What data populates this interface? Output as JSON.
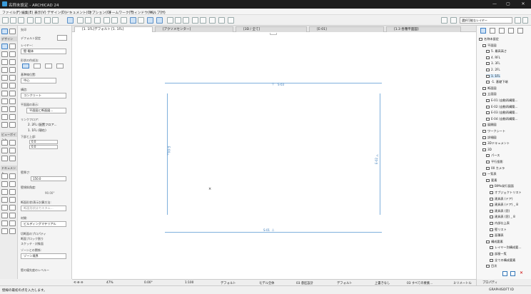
{
  "window": {
    "title": "名称未設定 - ARCHICAD 24",
    "minimize": "—",
    "maximize": "▢",
    "close": "✕"
  },
  "menu": [
    "ファイル(F)",
    "編集(E)",
    "表示(V)",
    "デザイン(D)",
    "ドキュメント(C)",
    "オプション(O)",
    "チームワーク(T)",
    "ウィンドウ(W)",
    "ヘルプ(H)"
  ],
  "toolbar": {
    "right_text": "選択可能なレイヤー"
  },
  "left_tools": {
    "select_label": "矢印",
    "sec_design": "デザイン",
    "sec_viewpoint": "ビューポイント",
    "sec_document": "ドキュメント"
  },
  "info": {
    "default_label": "デフォルト設定",
    "layer_label": "レイヤー:",
    "layer_value": "壁-躯体",
    "geometry_label": "形状の作成法:",
    "ref_label": "基準線位置:",
    "ref_value": "中心",
    "structure_label": "構造:",
    "structure_value": "コンクリート",
    "floor_label": "平面図の表示:",
    "floor_value": "平面図と断面図...",
    "link_label": "リンクフロア:",
    "top_story": "2. 2FL (配置フロア...",
    "home_story": "1. 1FL (現在)",
    "bottom_label": "下部と上部:",
    "bottom_val1": "0.0",
    "bottom_val2": "0.0",
    "thickness_label": "壁厚さ:",
    "thickness_value": "150.0",
    "slant_label": "壁傾斜角度:",
    "slant_value": "90.00°",
    "model_label": "断面形状/表示計算方法:",
    "model_value": "断面形状はカスタム...",
    "material_label": "材質:",
    "material_value": "ビルディングマテリアル",
    "r1": "切断面のプロパティ",
    "r2": "断面ブロック割り",
    "r3": "スケッチ・対象面",
    "zone_label": "ゾーンとの関係:",
    "zone_value": "ゾーン境界",
    "bottom_note": "壁の優先度のレベルー"
  },
  "tabs": [
    "[1. 1FL]デフォルト [1. 1FL]",
    "[アクソメセンター]",
    "[3D / 全て]",
    "[E-01]",
    "[1.3 各種平面図]"
  ],
  "canvas": {
    "label_top": "S-03",
    "label_bottom": "S-01",
    "label_left": "E-04",
    "label_right": "E-02"
  },
  "navigator": {
    "items": [
      {
        "t": "名称未設定",
        "d": 1
      },
      {
        "t": "平面図",
        "d": 2
      },
      {
        "t": "5. 最高高さ",
        "d": 3
      },
      {
        "t": "4. RFL",
        "d": 3
      },
      {
        "t": "3. 3FL",
        "d": 3
      },
      {
        "t": "2. 2FL",
        "d": 3
      },
      {
        "t": "1. 1FL",
        "d": 3,
        "sel": true
      },
      {
        "t": "-1. 基礎下端",
        "d": 3
      },
      {
        "t": "断面図",
        "d": 2
      },
      {
        "t": "立面図",
        "d": 2
      },
      {
        "t": "E-01 (自動再構築…",
        "d": 3
      },
      {
        "t": "E-02 (自動再構築…",
        "d": 3
      },
      {
        "t": "E-03 (自動再構築…",
        "d": 3
      },
      {
        "t": "E-04 (自動再構築…",
        "d": 3
      },
      {
        "t": "展開図",
        "d": 2
      },
      {
        "t": "ワークシート",
        "d": 2
      },
      {
        "t": "詳細図",
        "d": 2
      },
      {
        "t": "3Dドキュメント",
        "d": 2
      },
      {
        "t": "3D",
        "d": 2
      },
      {
        "t": "パース",
        "d": 3
      },
      {
        "t": "平行投影",
        "d": 3
      },
      {
        "t": "00 カメラ",
        "d": 3
      },
      {
        "t": "一覧表",
        "d": 2
      },
      {
        "t": "要素",
        "d": 3
      },
      {
        "t": "BIMx発行図面",
        "d": 4
      },
      {
        "t": "オブジェクトリスト",
        "d": 4
      },
      {
        "t": "建具表 (ドア)",
        "d": 4
      },
      {
        "t": "建具表 (ドア) _ 8",
        "d": 4
      },
      {
        "t": "建具表 (窓)",
        "d": 4
      },
      {
        "t": "建具表 (窓) _ 8",
        "d": 4
      },
      {
        "t": "内部仕上表",
        "d": 4
      },
      {
        "t": "壁リスト",
        "d": 4
      },
      {
        "t": "面積表",
        "d": 4
      },
      {
        "t": "構成要素",
        "d": 3
      },
      {
        "t": "レイヤー別構成要…",
        "d": 4
      },
      {
        "t": "部屋一覧",
        "d": 4
      },
      {
        "t": "全ての構成要素",
        "d": 4
      },
      {
        "t": "目次",
        "d": 3
      }
    ],
    "properties": "プロパティ",
    "graphisoft": "GRAPHISOFT ID"
  },
  "statusbar": {
    "zoom": "47%",
    "angle": "0.00°",
    "scale": "1:100",
    "layer": "デフォルト",
    "model": "モデル全体",
    "structure": "03 意匠設計",
    "pen": "デフォルト",
    "override": "上書きなし",
    "renovation": "03 すべての要素...",
    "dims": "ミリメートル"
  },
  "bottombar": {
    "prompt": "壁線の最初の点を入力します。"
  }
}
